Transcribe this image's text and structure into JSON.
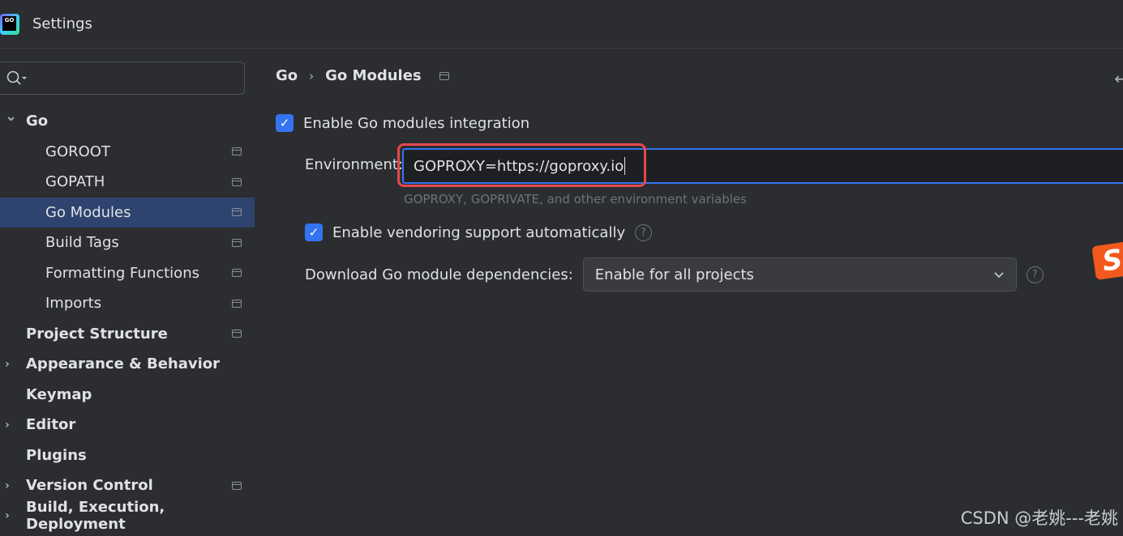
{
  "window": {
    "title": "Settings"
  },
  "search": {
    "placeholder": ""
  },
  "sidebar": {
    "items": [
      {
        "label": "Go",
        "expanded": true,
        "bold": true
      },
      {
        "label": "GOROOT"
      },
      {
        "label": "GOPATH"
      },
      {
        "label": "Go Modules",
        "selected": true
      },
      {
        "label": "Build Tags"
      },
      {
        "label": "Formatting Functions"
      },
      {
        "label": "Imports"
      },
      {
        "label": "Project Structure",
        "bold": true
      },
      {
        "label": "Appearance & Behavior",
        "bold": true
      },
      {
        "label": "Keymap",
        "bold": true
      },
      {
        "label": "Editor",
        "bold": true
      },
      {
        "label": "Plugins",
        "bold": true
      },
      {
        "label": "Version Control",
        "bold": true
      },
      {
        "label": "Build, Execution, Deployment",
        "bold": true
      }
    ]
  },
  "breadcrumb": {
    "parent": "Go",
    "sep": "›",
    "current": "Go Modules"
  },
  "main": {
    "enable_modules": {
      "label": "Enable Go modules integration",
      "checked": true
    },
    "environment": {
      "label": "Environment:",
      "value": "GOPROXY=https://goproxy.io",
      "hint": "GOPROXY, GOPRIVATE, and other environment variables"
    },
    "vendoring": {
      "label": "Enable vendoring support automatically",
      "checked": true
    },
    "download": {
      "label": "Download Go module dependencies:",
      "value": "Enable for all projects"
    }
  },
  "watermark": "CSDN @老姚---老姚",
  "colors": {
    "accent": "#3574f0",
    "highlight": "#e5484d",
    "selection": "#2e436e"
  }
}
